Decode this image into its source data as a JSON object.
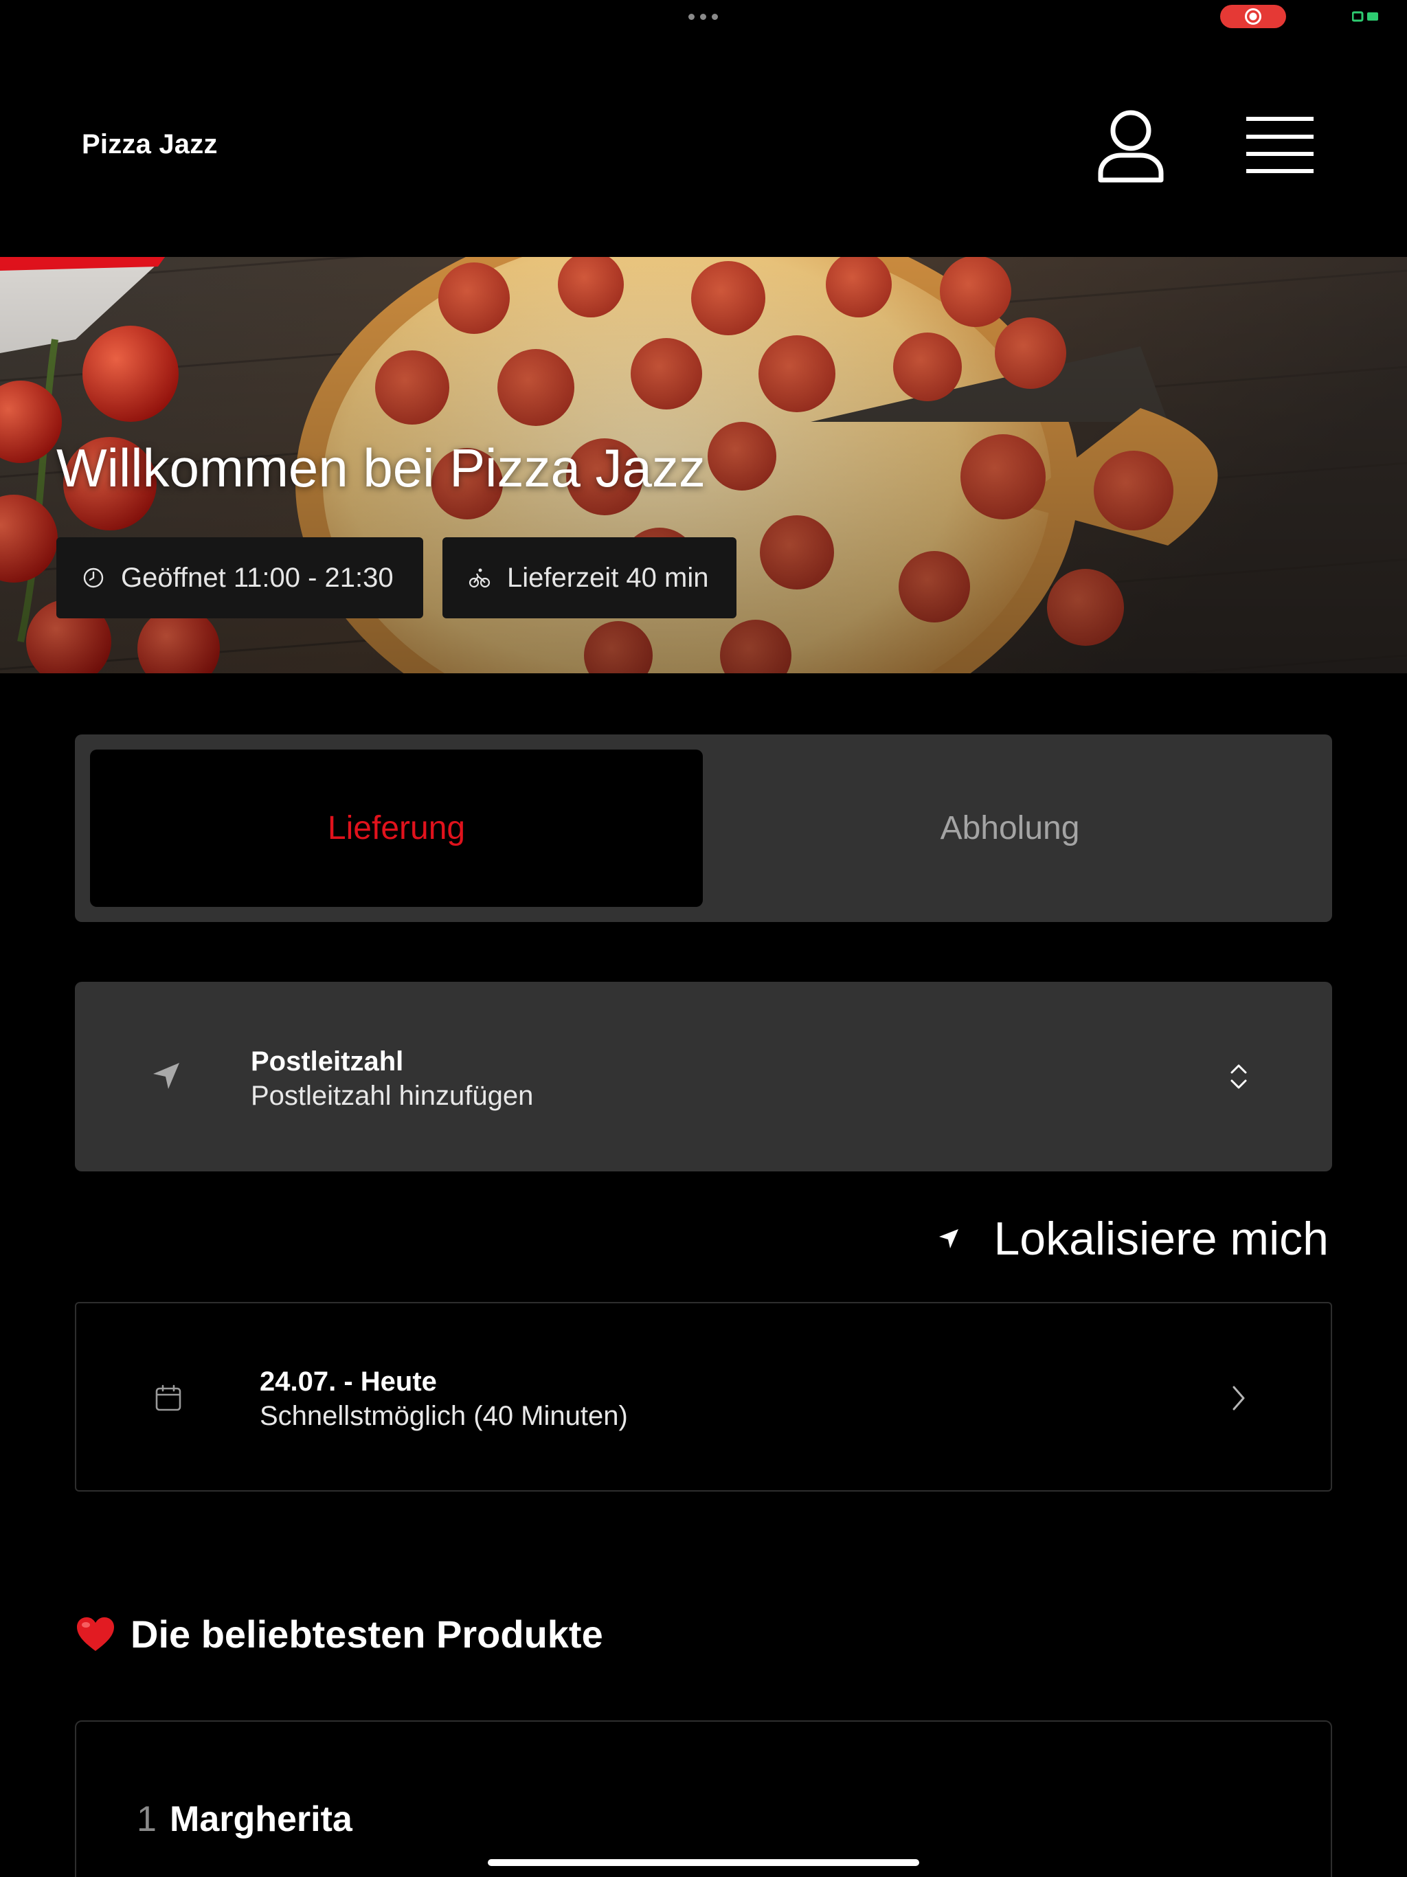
{
  "header": {
    "brand": "Pizza Jazz",
    "account_icon": "user-icon",
    "menu_icon": "hamburger-menu-icon"
  },
  "hero": {
    "title": "Willkommen bei Pizza Jazz",
    "opening_hours": "Geöffnet 11:00 - 21:30",
    "opening_hours_icon": "clock-icon",
    "delivery_time": "Lieferzeit 40 min",
    "delivery_time_icon": "bicycle-icon"
  },
  "order_mode": {
    "options": [
      "Lieferung",
      "Abholung"
    ],
    "selected": "Lieferung"
  },
  "postcode": {
    "title": "Postleitzahl",
    "placeholder": "Postleitzahl hinzufügen",
    "icon": "location-arrow-icon",
    "chevrons_icon": "up-down-chevrons-icon"
  },
  "locate_me": {
    "label": "Lokalisiere mich",
    "icon": "location-arrow-icon"
  },
  "date": {
    "title": "24.07. - Heute",
    "subtitle": "Schnellstmöglich (40 Minuten)",
    "icon": "calendar-icon"
  },
  "popular": {
    "heading": "Die beliebtesten Produkte",
    "heading_icon": "heart-icon",
    "products": [
      {
        "rank": "1",
        "name": "Margherita"
      }
    ]
  },
  "colors": {
    "accent": "#e0121c",
    "background": "#000000",
    "surface": "#333333",
    "chip": "#161616"
  }
}
